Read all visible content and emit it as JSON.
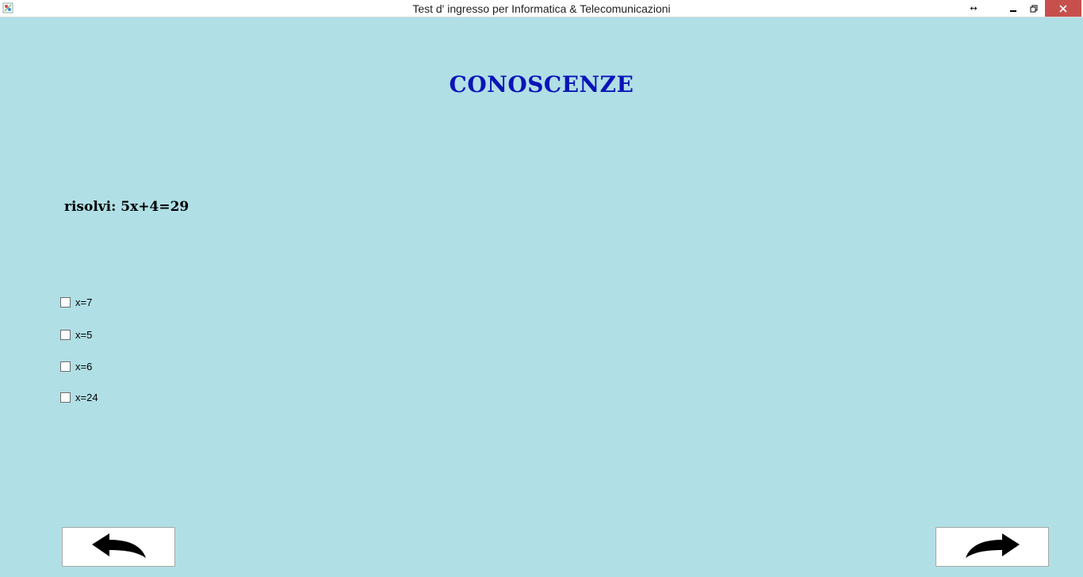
{
  "window": {
    "title": "Test d' ingresso per Informatica & Telecomunicazioni",
    "background": "#b0dfe5",
    "controls": {
      "resize_glyph": "↔",
      "minimize_glyph": "–",
      "maximize_glyph": "❐",
      "close_glyph": "✕",
      "close_color": "#c7504c"
    }
  },
  "heading": {
    "text": "CONOSCENZE",
    "color": "#0a14b8"
  },
  "question": {
    "text": "risolvi: 5x+4=29"
  },
  "options": [
    {
      "label": "x=7",
      "checked": false
    },
    {
      "label": "x=5",
      "checked": false
    },
    {
      "label": "x=6",
      "checked": false
    },
    {
      "label": "x=24",
      "checked": false
    }
  ],
  "navigation": {
    "back_icon": "arrow-back-icon",
    "next_icon": "arrow-forward-icon"
  }
}
